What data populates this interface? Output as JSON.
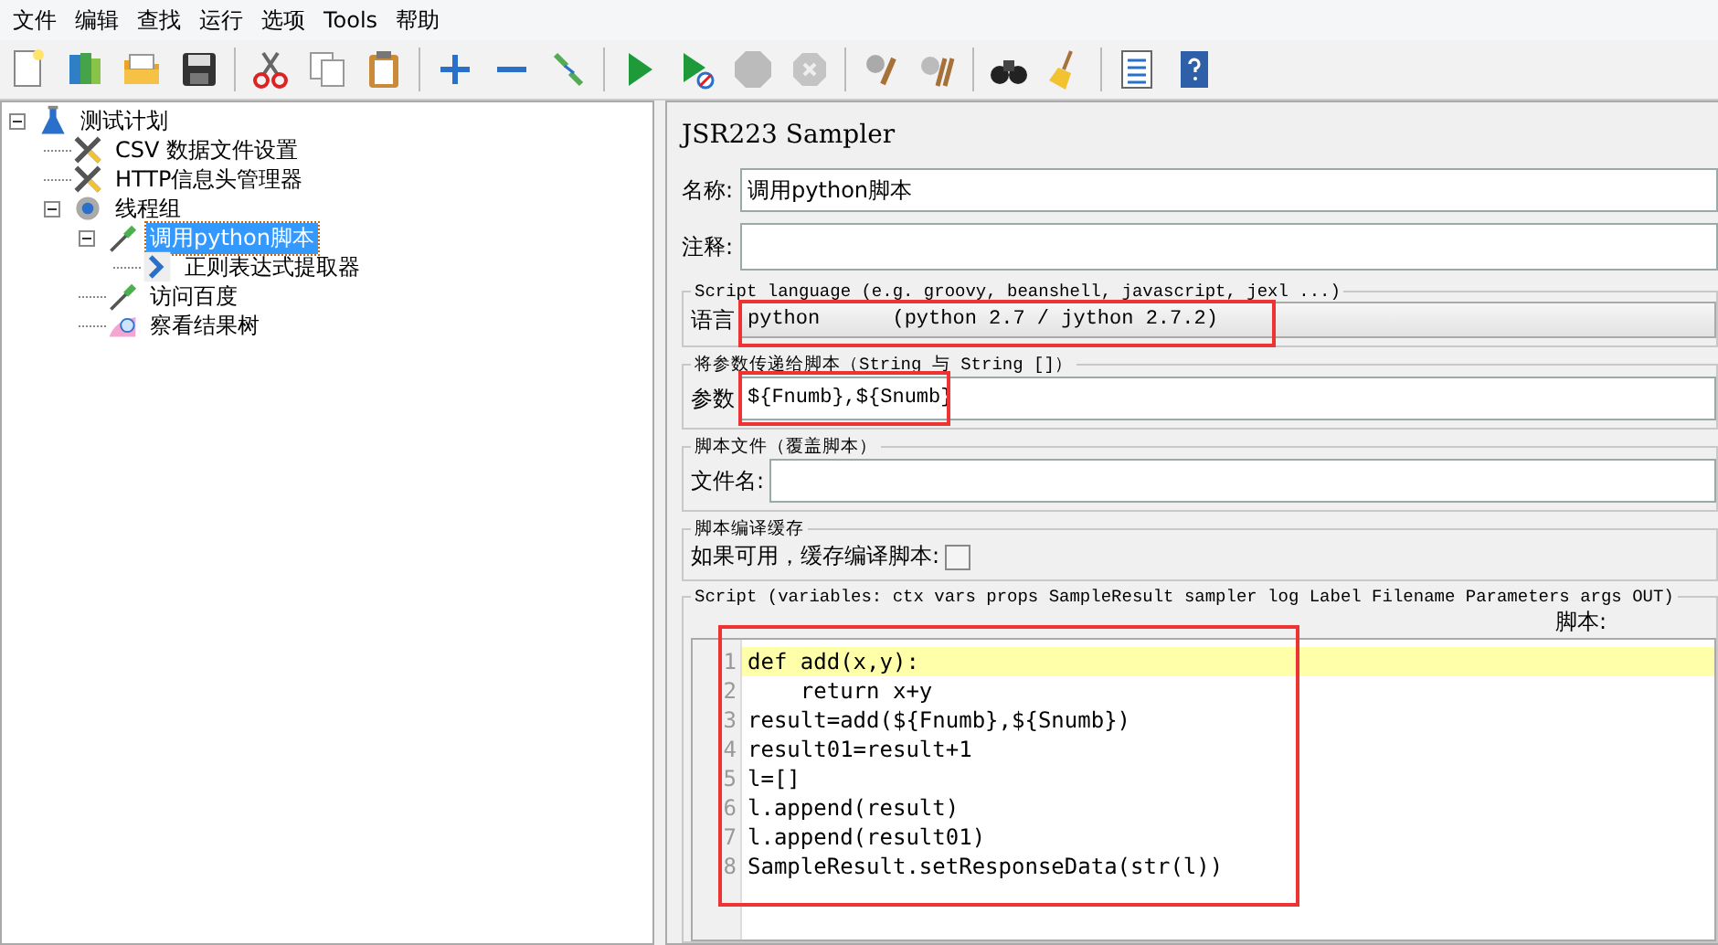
{
  "menu": [
    "文件",
    "编辑",
    "查找",
    "运行",
    "选项",
    "Tools",
    "帮助"
  ],
  "tree": [
    {
      "label": "测试计划",
      "kind": "plan",
      "selected": false,
      "expanded": true,
      "children": [
        {
          "label": "CSV 数据文件设置",
          "kind": "config",
          "selected": false
        },
        {
          "label": "HTTP信息头管理器",
          "kind": "config",
          "selected": false
        },
        {
          "label": "线程组",
          "kind": "threadgroup",
          "selected": false,
          "expanded": true,
          "children": [
            {
              "label": "调用python脚本",
              "kind": "sampler",
              "selected": true,
              "expanded": true,
              "children": [
                {
                  "label": "正则表达式提取器",
                  "kind": "extractor",
                  "selected": false
                }
              ]
            },
            {
              "label": "访问百度",
              "kind": "sampler",
              "selected": false
            },
            {
              "label": "察看结果树",
              "kind": "listener",
              "selected": false
            }
          ]
        }
      ]
    }
  ],
  "panel": {
    "title": "JSR223 Sampler",
    "name": {
      "label": "名称:",
      "value": "调用python脚本"
    },
    "comment": {
      "label": "注释:"
    },
    "language": {
      "legend": "Script language (e.g. groovy, beanshell, javascript, jexl ...)",
      "label": "语言",
      "value": "python      (python 2.7 / jython 2.7.2)",
      "highlighted": true
    },
    "parameters": {
      "legend": "将参数传递给脚本（String 与 String []）",
      "label": "参数",
      "value": "${Fnumb},${Snumb}",
      "highlighted": true
    },
    "file": {
      "legend": "脚本文件（覆盖脚本）",
      "label": "文件名:"
    },
    "cache": {
      "legend": "脚本编译缓存",
      "label": "如果可用，缓存编译脚本:",
      "checked": false
    },
    "script": {
      "legend": "Script (variables: ctx vars props SampleResult sampler log Label Filename Parameters args OUT)",
      "label": "脚本:",
      "highlighted": true,
      "lines": [
        {
          "number": "1",
          "text": "def add(x,y):",
          "current": true
        },
        {
          "number": "2",
          "text": "    return x+y",
          "current": false
        },
        {
          "number": "3",
          "text": "result=add(${Fnumb},${Snumb})",
          "current": false
        },
        {
          "number": "4",
          "text": "result01=result+1",
          "current": false
        },
        {
          "number": "5",
          "text": "l=[]",
          "current": false
        },
        {
          "number": "6",
          "text": "l.append(result)",
          "current": false
        },
        {
          "number": "7",
          "text": "l.append(result01)",
          "current": false
        },
        {
          "number": "8",
          "text": "SampleResult.setResponseData(str(l))",
          "current": false
        }
      ]
    }
  }
}
